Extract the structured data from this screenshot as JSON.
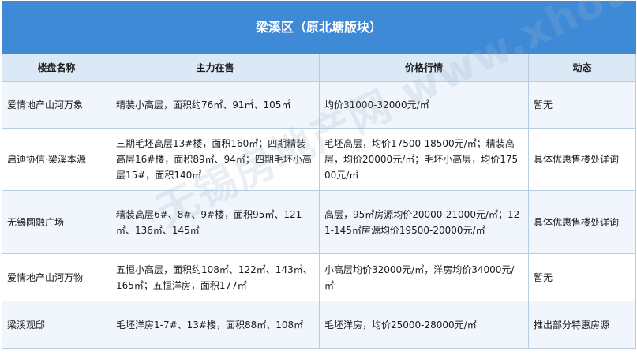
{
  "table": {
    "title": "梁溪区（原北塘版块）",
    "headers": [
      "楼盘名称",
      "主力在售",
      "价格行情",
      "动态"
    ],
    "rows": [
      {
        "name": "爱情地产山河万象",
        "supply": "精装小高层，面积约76㎡、91㎡、105㎡",
        "price": "均价31000-32000元/㎡",
        "status": "暂无"
      },
      {
        "name": "启迪协信·梁溪本源",
        "supply": "三期毛坯高层13#楼，面积160㎡；四期精装高层16#楼，面积89㎡、94㎡；四期毛坯小高层15#，面积140㎡",
        "price": "毛坯高层，均价17500-18500元/㎡；精装高层，均价20000元/㎡；毛坯小高层，均价17500元/㎡",
        "status": "具体优惠售楼处详询"
      },
      {
        "name": "无锡圆融广场",
        "supply": "精装高层6#、8#、9#楼，面积95㎡、121㎡、136㎡、145㎡",
        "price": "高层，95㎡房源均价20000-21000元/㎡；121-145㎡房源均价19500-20000元/㎡",
        "status": "具体优惠售楼处详询"
      },
      {
        "name": "爱情地产山河万物",
        "supply": "五恒小高层，面积约108㎡、122㎡、143㎡、165㎡；五恒洋房，面积177㎡",
        "price": "小高层均价32000元/㎡，洋房均价34000元/㎡",
        "status": "暂无"
      },
      {
        "name": "梁溪观邸",
        "supply": "毛坯洋房1-7#、13#楼，面积88㎡、108㎡",
        "price": "毛坯洋房，均价25000-28000元/㎡",
        "status": "推出部分特惠房源"
      }
    ]
  },
  "watermark": {
    "text": "无锡房地产网 www.xhouse.com"
  }
}
